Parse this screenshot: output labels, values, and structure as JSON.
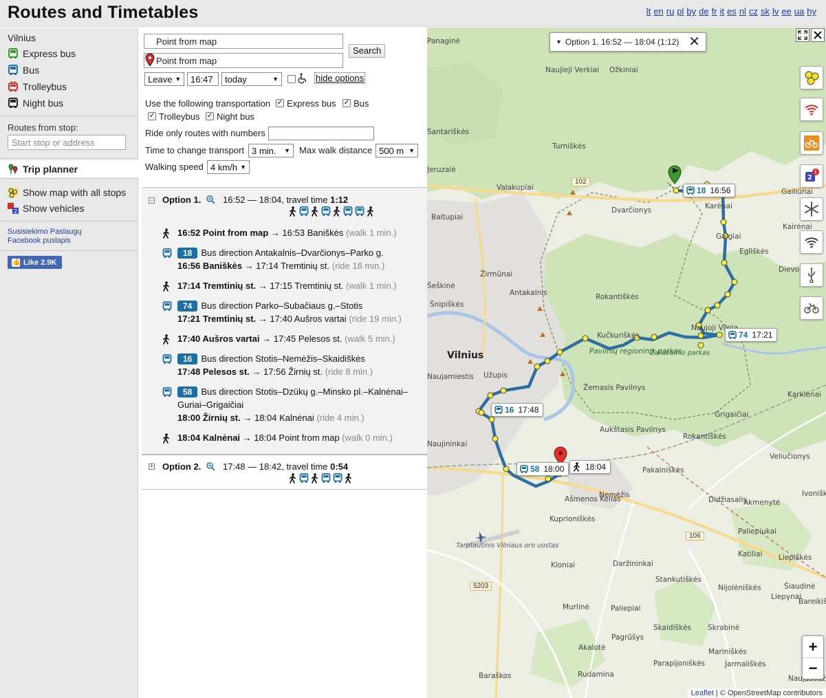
{
  "header": {
    "title": "Routes and Timetables",
    "languages": [
      "lt",
      "en",
      "ru",
      "pl",
      "by",
      "de",
      "fr",
      "it",
      "es",
      "nl",
      "cz",
      "sk",
      "lv",
      "ee",
      "ua",
      "hy"
    ]
  },
  "sidebar": {
    "city": "Vilnius",
    "transport": [
      {
        "label": "Express bus",
        "icon": "express-bus-icon",
        "color": "#3a9a2d"
      },
      {
        "label": "Bus",
        "icon": "bus-icon",
        "color": "#1c6ea4"
      },
      {
        "label": "Trolleybus",
        "icon": "trolleybus-icon",
        "color": "#d42b2b"
      },
      {
        "label": "Night bus",
        "icon": "night-bus-icon",
        "color": "#222222"
      }
    ],
    "routes_from_stop_label": "Routes from stop:",
    "stop_placeholder": "Start stop or address",
    "trip_planner": "Trip planner",
    "show_map": "Show map with all stops",
    "show_vehicles": "Show vehicles",
    "link1": "Susisiekimo Paslaugų",
    "link2": "Facebook puslapis",
    "fb_like": "Like 2.9K"
  },
  "planner": {
    "from_value": "Point from map",
    "to_value": "Point from map",
    "search_button": "Search",
    "leave_select": "Leave",
    "time_value": "16:47",
    "day_select": "today",
    "hide_options": "hide options",
    "use_transport_label": "Use the following transportation",
    "opt_express": "Express bus",
    "opt_bus": "Bus",
    "opt_trolley": "Trolleybus",
    "opt_night": "Night bus",
    "ride_only_label": "Ride only routes with numbers",
    "ride_only_value": "",
    "change_label": "Time to change transport",
    "change_value": "3 min.",
    "walk_label": "Max walk distance",
    "walk_value": "500 m",
    "speed_label": "Walking speed",
    "speed_value": "4 km/h"
  },
  "options": [
    {
      "title": "Option 1.",
      "times": "16:52 — 18:04, travel time ",
      "travel_time": "1:12",
      "modes": [
        "walk",
        "bus",
        "walk",
        "bus",
        "walk",
        "bus",
        "bus",
        "walk"
      ],
      "legs": [
        {
          "type": "walk",
          "bold": "16:52 Point from map",
          "rest": " → 16:53 Baniškės ",
          "note": "(walk 1 min.)"
        },
        {
          "type": "bus",
          "route": "18",
          "direction": "Bus direction Antakalnis–Dvarčionys–Parko g.",
          "bold": "16:56 Baniškės",
          "rest": " → 17:14 Tremtinių st. ",
          "note": "(ride 18 min.)"
        },
        {
          "type": "walk",
          "bold": "17:14 Tremtinių st.",
          "rest": " → 17:15 Tremtinių st. ",
          "note": "(walk 1 min.)"
        },
        {
          "type": "bus",
          "route": "74",
          "direction": "Bus direction Parko–Subačiaus g.–Stotis",
          "bold": "17:21 Tremtinių st.",
          "rest": " → 17:40 Aušros vartai ",
          "note": "(ride 19 min.)"
        },
        {
          "type": "walk",
          "bold": "17:40 Aušros vartai",
          "rest": " → 17:45 Pelesos st. ",
          "note": "(walk 5 min.)"
        },
        {
          "type": "bus",
          "route": "16",
          "direction": "Bus direction Stotis–Nemėžis–Skaidiškės",
          "bold": "17:48 Pelesos st.",
          "rest": " → 17:56 Žirnių st. ",
          "note": "(ride 8 min.)"
        },
        {
          "type": "bus",
          "route": "58",
          "direction": "Bus direction Stotis–Dzūkų g.–Minsko pl.–Kalnėnai–",
          "direction2": "Guriai–Grigaičiai",
          "bold": "18:00 Žirnių st.",
          "rest": " → 18:04 Kalnėnai ",
          "note": "(ride 4 min.)"
        },
        {
          "type": "walk",
          "bold": "18:04 Kalnėnai",
          "rest": " → 18:04 Point from map ",
          "note": "(walk 0 min.)"
        }
      ]
    },
    {
      "title": "Option 2.",
      "times": "17:48 — 18:42, travel time ",
      "travel_time": "0:54",
      "modes": [
        "walk",
        "bus",
        "walk",
        "bus",
        "bus",
        "walk"
      ]
    }
  ],
  "map": {
    "popup_text": "Option 1.  16:52 — 18:04 (1:12)",
    "bubbles": [
      {
        "route": "18",
        "time": "16:56"
      },
      {
        "route": "74",
        "time": "17:21"
      },
      {
        "route": "16",
        "time": "17:48"
      },
      {
        "route": "58",
        "time": "18:00"
      },
      {
        "route": "",
        "time": "18:04"
      }
    ],
    "places": [
      "Panaginė",
      "Naujieji Verkiai",
      "Ožkiniai",
      "Santariškės",
      "Turniškės",
      "Jeruzalė",
      "Valakupiai",
      "Dvarčionys",
      "Baltupiai",
      "Karėnai",
      "Galgiai",
      "Gailiūnai",
      "Kairėnai",
      "Šeškinė",
      "Žirmūnai",
      "Antakalnis",
      "Šnipiškės",
      "Rokantiškės",
      "Dievonys",
      "Naujoji Vilnia",
      "Kučkuriškės",
      "Vilnius",
      "Užupis",
      "Naujamiestis",
      "Žemasis Pavilnys",
      "Karklėnai",
      "Grigaičiai",
      "Aukštasis Pavilnys",
      "Rokantiškės",
      "Veliučionys",
      "Naujininkai",
      "Pakalniškės",
      "Ašmenos Kelias",
      "Nemėžis",
      "Didžiasalis",
      "Akmenytė",
      "Kuprioniškės",
      "Paliepiukai",
      "Daržininkai",
      "Katiliai",
      "Liepiškės",
      "Kloniai",
      "Stankutiškės",
      "Nijolėniškės",
      "Šiaudinė",
      "Liepynai",
      "Murlinė",
      "Paliepiai",
      "Bareikiškės",
      "Skaidiškės",
      "Skrabinė",
      "Pagrūšys",
      "Akalotė",
      "Mariniškės",
      "Parapijoniškės",
      "Jarmališkės",
      "Naujasodžiai",
      "Baraškos",
      "Rudamina",
      "Egliškės",
      "Ivoniškės"
    ],
    "park_label": "Pavilnių regioninis parkas",
    "park_label2": "Žaliakalnio parkas",
    "airport_label": "Tarptautinis Vilniaus oro uostas",
    "road_102": "102",
    "road_106": "106",
    "road_5203": "5203",
    "zoom_in": "+",
    "zoom_out": "−",
    "attrib_leaflet": "Leaflet",
    "attrib_osm": "© OpenStreetMap contributors",
    "route_color": "#2d6fa0"
  }
}
